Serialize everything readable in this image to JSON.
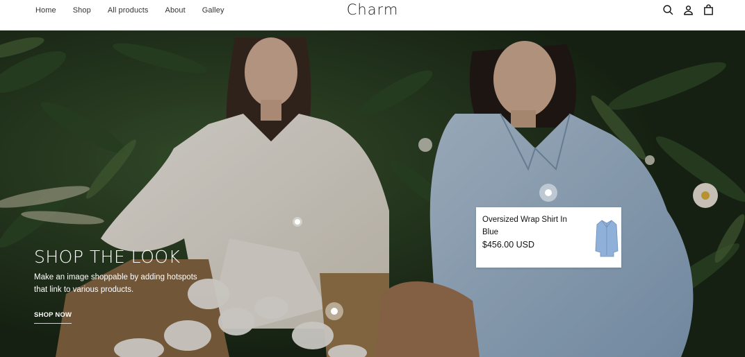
{
  "header": {
    "nav": [
      {
        "label": "Home"
      },
      {
        "label": "Shop"
      },
      {
        "label": "All products"
      },
      {
        "label": "About"
      },
      {
        "label": "Galley"
      }
    ],
    "logo": "Charm",
    "icons": [
      "search-icon",
      "user-icon",
      "bag-icon"
    ]
  },
  "hero": {
    "title": "SHOP THE LOOK",
    "subtitle": "Make an image shoppable by adding hotspots that link to various products.",
    "cta": "SHOP NOW"
  },
  "product_card": {
    "name": "Oversized Wrap Shirt In Blue",
    "price": "$456.00 USD",
    "thumb_color": "#8fb0d8"
  },
  "colors": {
    "header_bg": "#ffffff",
    "foliage_dark": "#1c2a1a",
    "shirt_white": "#f2ede4",
    "shirt_blue": "#a9bfd6"
  }
}
